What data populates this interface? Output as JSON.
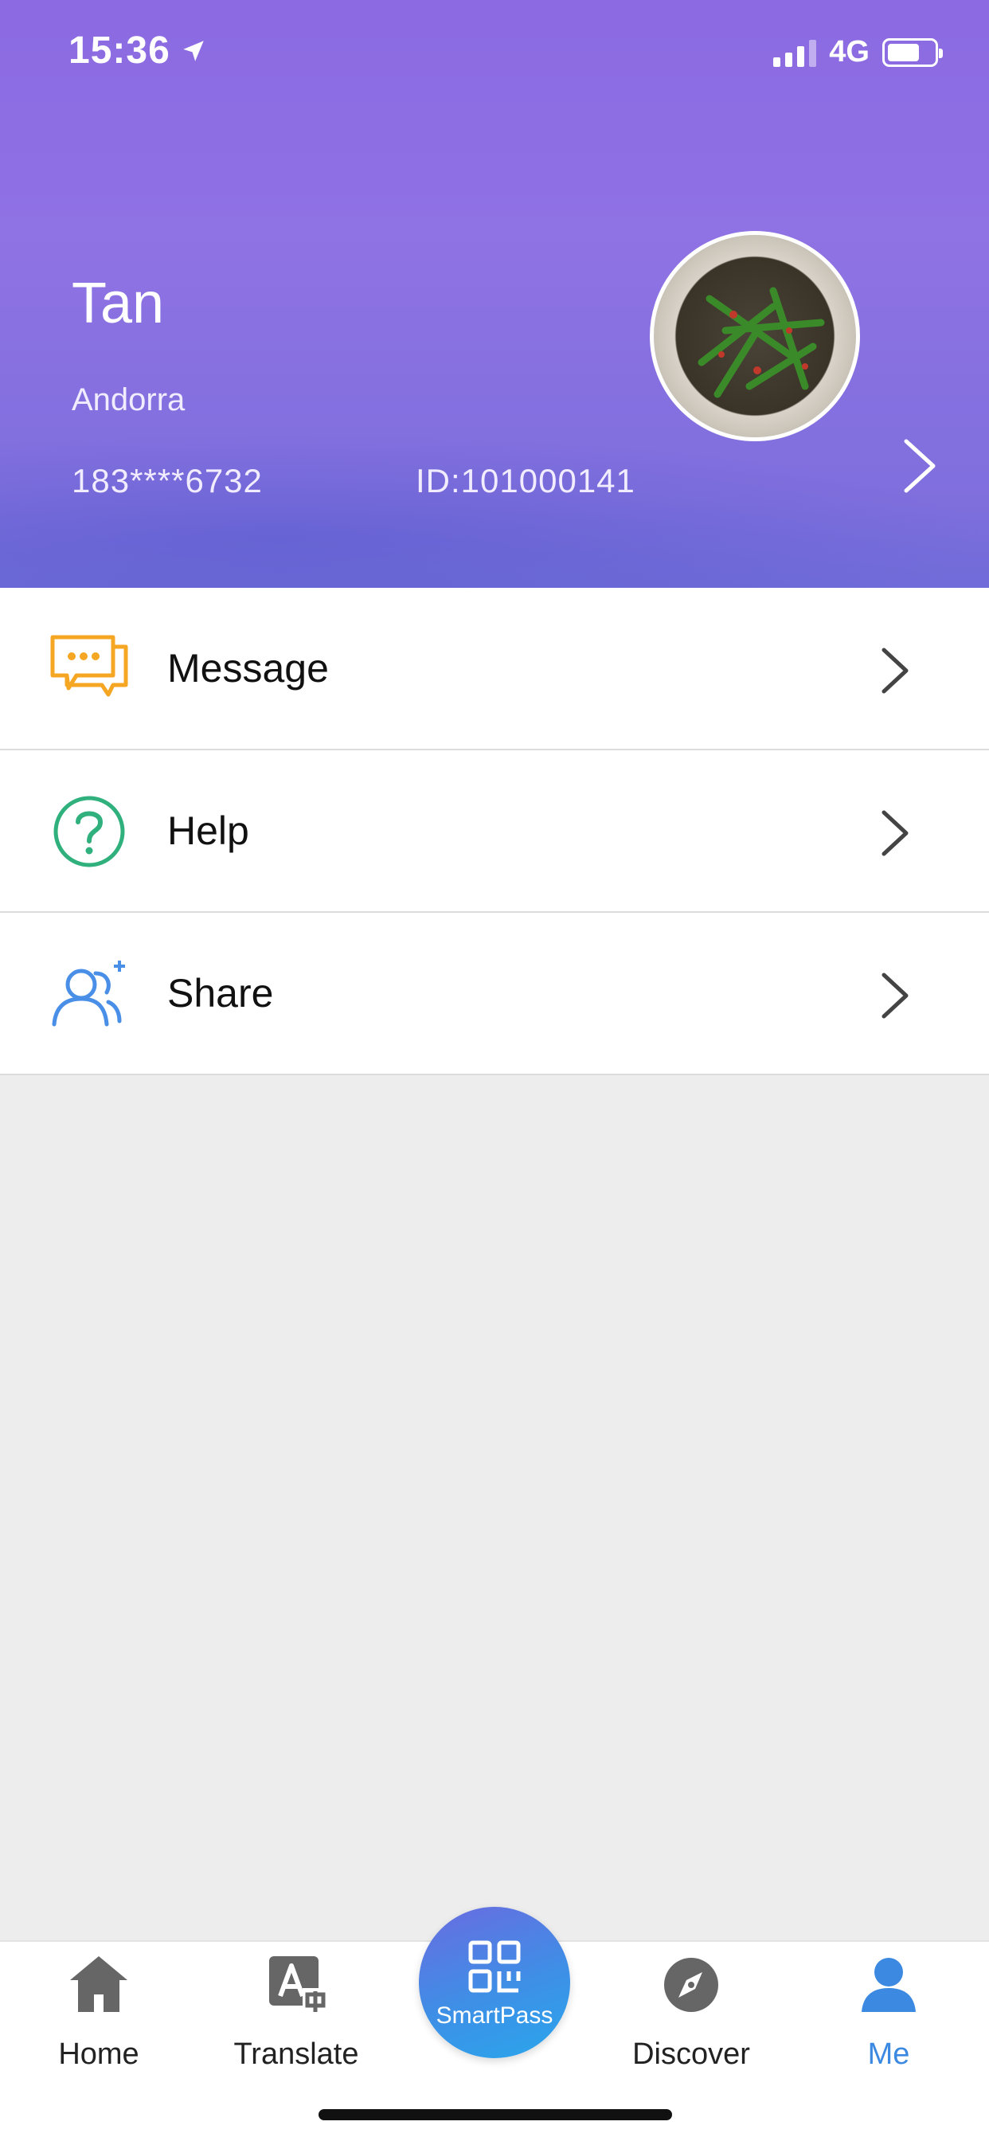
{
  "status_bar": {
    "time": "15:36",
    "network": "4G"
  },
  "profile": {
    "name": "Tan",
    "region": "Andorra",
    "phone": "183****6732",
    "id": "ID:101000141",
    "avatar_icon": "food-photo-avatar"
  },
  "menu": {
    "items": [
      {
        "label": "Message",
        "icon": "message-bubbles-icon",
        "color": "#f5a623"
      },
      {
        "label": "Help",
        "icon": "question-circle-icon",
        "color": "#2fb07c"
      },
      {
        "label": "Share",
        "icon": "add-user-icon",
        "color": "#4a8fe7"
      }
    ]
  },
  "tabbar": {
    "home": "Home",
    "translate": "Translate",
    "smartpass": "SmartPass",
    "discover": "Discover",
    "me": "Me",
    "active_color": "#3b89e0"
  },
  "colors": {
    "header_gradient_top": "#8c6ae2",
    "page_background": "#ededed"
  }
}
